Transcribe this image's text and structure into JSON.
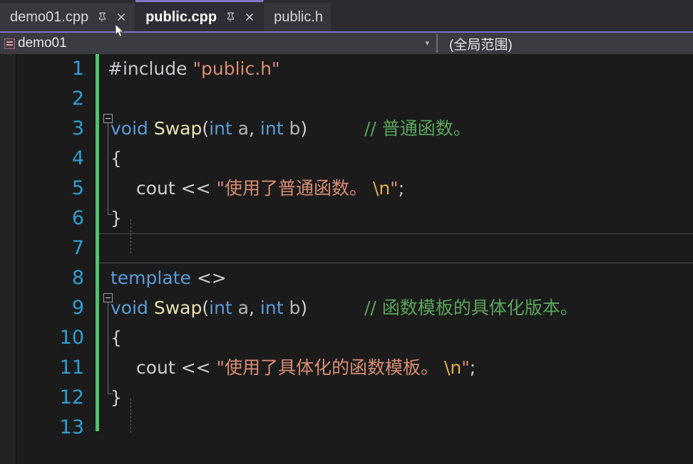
{
  "window": {
    "app": "Visual Studio",
    "theme_background": "#1b1b1c"
  },
  "tabs": [
    {
      "label": "demo01.cpp",
      "active": false,
      "pinnable": true,
      "closable": true,
      "pin_icon": "pin-icon",
      "close_icon": "close-icon"
    },
    {
      "label": "public.cpp",
      "active": true,
      "pinnable": true,
      "closable": true,
      "pin_icon": "pin-icon",
      "close_icon": "close-icon"
    },
    {
      "label": "public.h",
      "active": false,
      "pinnable": false,
      "closable": false,
      "pin_icon": "",
      "close_icon": ""
    }
  ],
  "navbar": {
    "scope_selector": {
      "label": "demo01",
      "icon": "namespace-icon",
      "caret": "▾"
    },
    "member_selector": {
      "label": "(全局范围)",
      "caret": ""
    }
  },
  "editor": {
    "line_number_color": "#2f9fd0",
    "change_bar_color": "#4ec36a",
    "current_line": 7,
    "line_count": 13,
    "lines": [
      {
        "n": "1",
        "text": "#include \"public.h\""
      },
      {
        "n": "2",
        "text": ""
      },
      {
        "n": "3",
        "text": "void Swap(int a, int b)      // 普通函数。"
      },
      {
        "n": "4",
        "text": "{"
      },
      {
        "n": "5",
        "text": "    cout << \"使用了普通函数。\\n\";"
      },
      {
        "n": "6",
        "text": "}"
      },
      {
        "n": "7",
        "text": ""
      },
      {
        "n": "8",
        "text": "template <>"
      },
      {
        "n": "9",
        "text": "void Swap(int a, int b)      // 函数模板的具体化版本。"
      },
      {
        "n": "10",
        "text": "{"
      },
      {
        "n": "11",
        "text": "    cout << \"使用了具体化的函数模板。\\n\";"
      },
      {
        "n": "12",
        "text": "}"
      },
      {
        "n": "13",
        "text": ""
      }
    ],
    "tokens": {
      "l1_include": "#include ",
      "l1_header": "\"public.h\"",
      "l3_void": "void ",
      "l3_name": "Swap",
      "l3_open": "(",
      "l3_int1": "int",
      "l3_a": " a",
      "l3_comma": ", ",
      "l3_int2": "int",
      "l3_b": " b",
      "l3_close": ")",
      "l3_comment": "// 普通函数。",
      "l4_brace": "{",
      "l5_cout": "cout ",
      "l5_shift": "<< ",
      "l5_str": "\"使用了普通函数。 ",
      "l5_esc": "\\n",
      "l5_strend": "\"",
      "l5_semi": ";",
      "l6_brace": "}",
      "l8_template": "template ",
      "l8_angles": "<>",
      "l9_void": "void ",
      "l9_name": "Swap",
      "l9_open": "(",
      "l9_int1": "int",
      "l9_a": " a",
      "l9_comma": ", ",
      "l9_int2": "int",
      "l9_b": " b",
      "l9_close": ")",
      "l9_comment": "// 函数模板的具体化版本。",
      "l10_brace": "{",
      "l11_cout": "cout ",
      "l11_shift": "<< ",
      "l11_str": "\"使用了具体化的函数模板。 ",
      "l11_esc": "\\n",
      "l11_strend": "\"",
      "l11_semi": ";",
      "l12_brace": "}"
    }
  },
  "colors": {
    "keyword": "#5b9bd5",
    "function": "#e8e2b0",
    "string": "#d98c73",
    "escape": "#e0b050",
    "comment": "#59a559",
    "tabbar_bg": "#2b2b30",
    "navbar_bg": "#3b3b42",
    "active_tab_accent": "#8478c7"
  }
}
